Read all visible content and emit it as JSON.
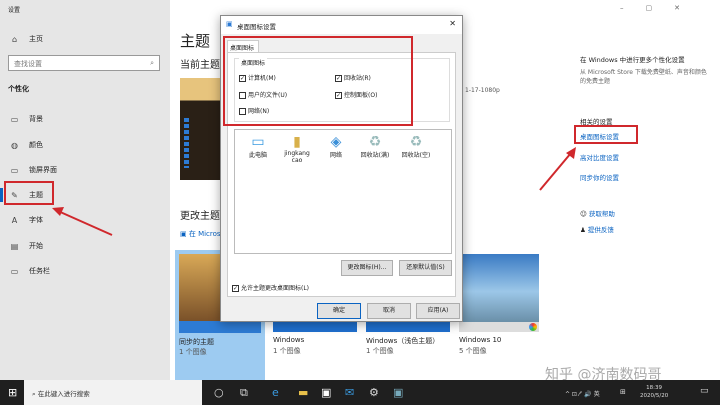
{
  "window": {
    "title": "设置",
    "min": "–",
    "max": "▢",
    "close": "✕"
  },
  "sidebar": {
    "home": "主页",
    "search_placeholder": "查找设置",
    "section": "个性化",
    "items": [
      {
        "label": "背景",
        "icon": "picture-icon"
      },
      {
        "label": "颜色",
        "icon": "palette-icon"
      },
      {
        "label": "锁屏界面",
        "icon": "lock-screen-icon"
      },
      {
        "label": "主题",
        "icon": "theme-icon"
      },
      {
        "label": "字体",
        "icon": "font-icon"
      },
      {
        "label": "开始",
        "icon": "start-icon"
      },
      {
        "label": "任务栏",
        "icon": "taskbar-icon"
      }
    ]
  },
  "main": {
    "title": "主题",
    "current_theme": "当前主题",
    "wallpaper_name": "1-17-1080p",
    "change_theme": "更改主题",
    "store_link": "在 Microsoft Store 中获取更多主题",
    "themes": [
      {
        "name": "同步的主题",
        "count": "1 个图像"
      },
      {
        "name": "Windows",
        "count": "1 个图像"
      },
      {
        "name": "Windows（浅色主题）",
        "count": "1 个图像"
      },
      {
        "name": "Windows 10",
        "count": "5 个图像"
      }
    ],
    "right": {
      "more_title": "在 Windows 中进行更多个性化设置",
      "more_desc": "从 Microsoft Store 下载免费壁纸、声音和颜色的免费主题",
      "related": "相关的设置",
      "links": [
        "桌面图标设置",
        "高对比度设置",
        "同步你的设置"
      ],
      "help": "获取帮助",
      "feedback": "提供反馈"
    }
  },
  "dialog": {
    "title": "桌面图标设置",
    "tab": "桌面图标",
    "group": "桌面图标",
    "checks": [
      {
        "label": "计算机(M)",
        "checked": true
      },
      {
        "label": "回收站(R)",
        "checked": true
      },
      {
        "label": "用户的文件(U)",
        "checked": false
      },
      {
        "label": "控制面板(O)",
        "checked": true
      },
      {
        "label": "网络(N)",
        "checked": false
      }
    ],
    "icons": [
      "此电脑",
      "jingkang cao",
      "网络",
      "回收站(满)",
      "回收站(空)"
    ],
    "change_icon": "更改图标(H)...",
    "restore": "还原默认值(S)",
    "allow": "允许主题更改桌面图标(L)",
    "ok": "确定",
    "cancel": "取消",
    "apply": "应用(A)"
  },
  "taskbar": {
    "search": "在此键入进行搜索",
    "time": "18:39",
    "date": "2020/5/20",
    "tray": "^ ⊡ ⁄ᐟ 🔊 英"
  },
  "watermark": "知乎 @济南数码哥"
}
